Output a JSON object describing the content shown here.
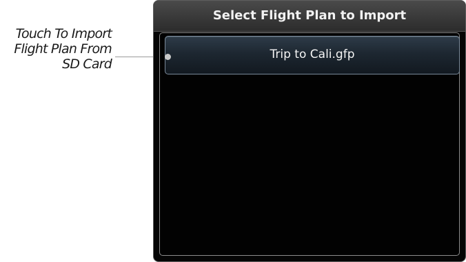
{
  "annotation": {
    "lines": [
      "Touch To Import",
      "Flight Plan From",
      "SD Card"
    ]
  },
  "dialog": {
    "title": "Select Flight Plan to Import",
    "files": [
      {
        "name": "Trip to Cali.gfp"
      }
    ]
  }
}
